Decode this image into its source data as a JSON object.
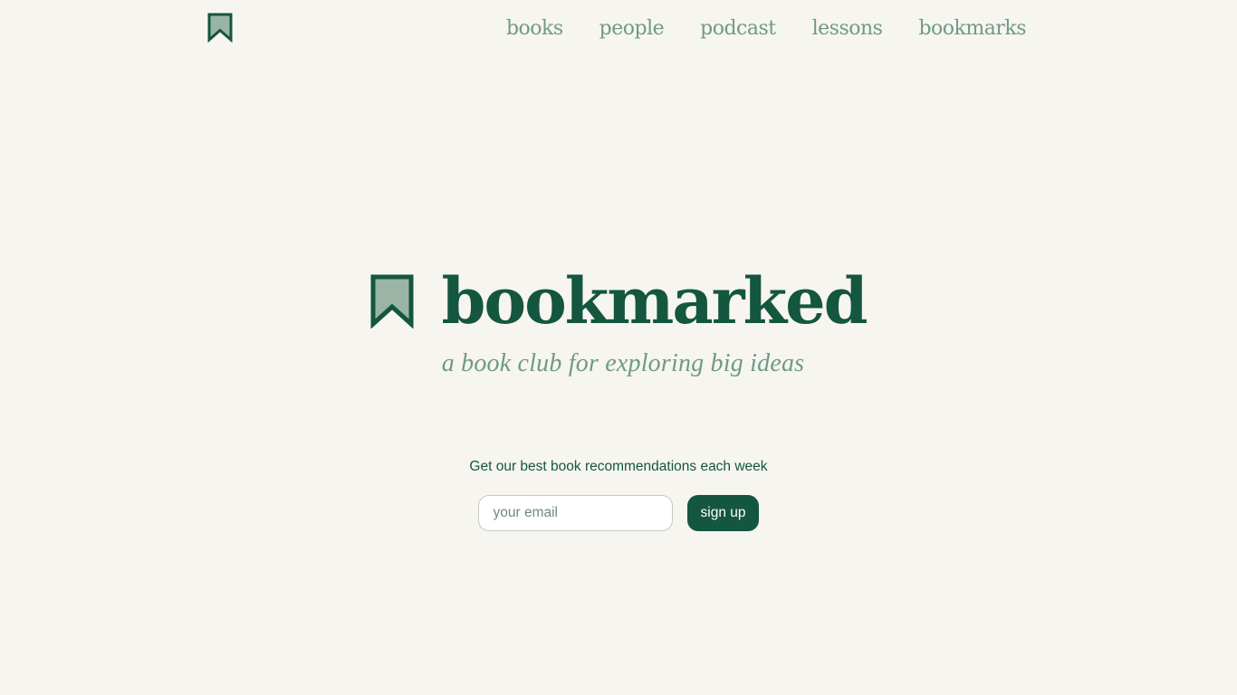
{
  "header": {
    "logo_icon": "bookmark-icon",
    "nav": [
      {
        "label": "books"
      },
      {
        "label": "people"
      },
      {
        "label": "podcast"
      },
      {
        "label": "lessons"
      },
      {
        "label": "bookmarks"
      }
    ]
  },
  "hero": {
    "logo_icon": "bookmark-icon",
    "title": "bookmarked",
    "tagline": "a book club for exploring big ideas"
  },
  "signup": {
    "label": "Get our best book recommendations each week",
    "email_placeholder": "your email",
    "email_value": "",
    "button_label": "sign up"
  },
  "colors": {
    "background": "#f6f5f0",
    "brand_dark_green": "#14563f",
    "muted_green": "#6f9a86",
    "icon_fill": "#9ab5a6"
  }
}
